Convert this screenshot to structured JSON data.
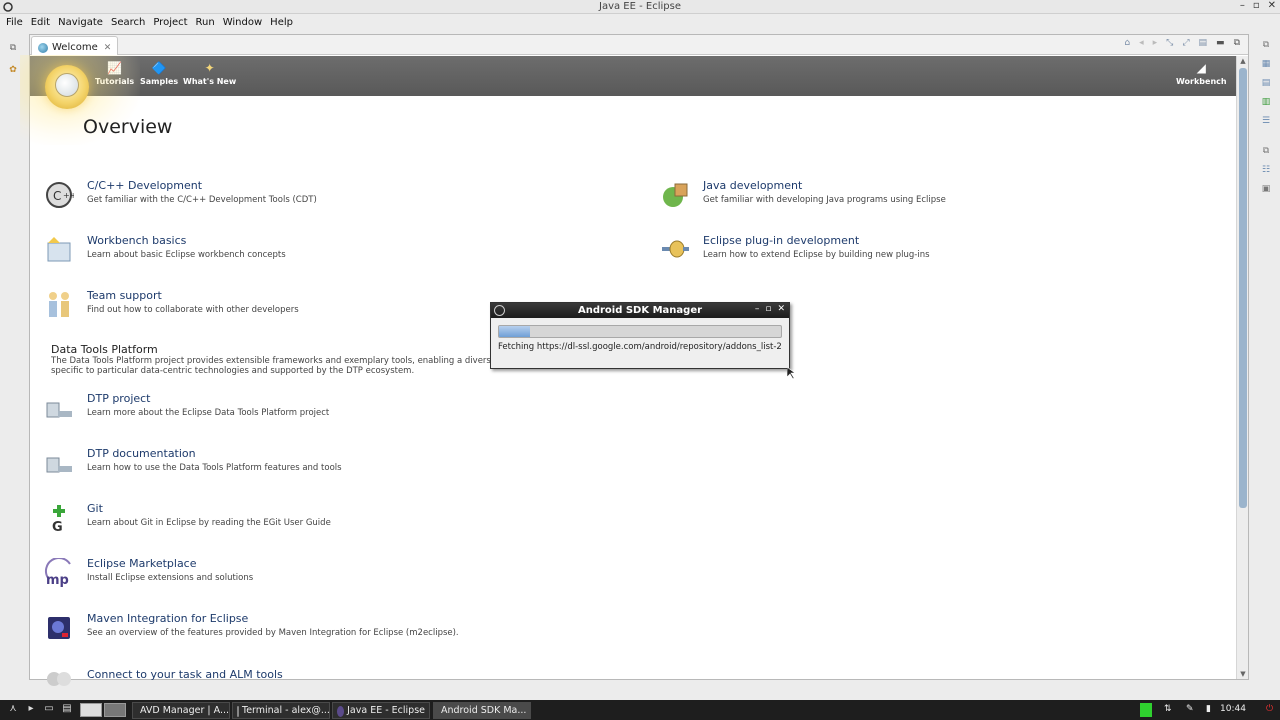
{
  "window": {
    "title": "Java EE - Eclipse"
  },
  "menu": [
    "File",
    "Edit",
    "Navigate",
    "Search",
    "Project",
    "Run",
    "Window",
    "Help"
  ],
  "tab": {
    "label": "Welcome",
    "close": "✕"
  },
  "header": {
    "links": [
      {
        "label": "Tutorials",
        "icon": "tutorials-icon"
      },
      {
        "label": "Samples",
        "icon": "samples-icon"
      },
      {
        "label": "What's New",
        "icon": "whats-new-icon"
      }
    ],
    "workbench": "Workbench"
  },
  "overview": {
    "title": "Overview"
  },
  "items": [
    {
      "title": "C/C++ Development",
      "desc": "Get familiar with the C/C++ Development Tools (CDT)"
    },
    {
      "title": "Workbench basics",
      "desc": "Learn about basic Eclipse workbench concepts"
    },
    {
      "title": "Team support",
      "desc": "Find out how to collaborate with other developers"
    },
    {
      "title": "DTP project",
      "desc": "Learn more about the Eclipse Data Tools Platform project"
    },
    {
      "title": "DTP documentation",
      "desc": "Learn how to use the Data Tools Platform features and tools"
    },
    {
      "title": "Git",
      "desc": "Learn about Git in Eclipse by reading the EGit User Guide"
    },
    {
      "title": "Eclipse Marketplace",
      "desc": "Install Eclipse extensions and solutions"
    },
    {
      "title": "Maven Integration for Eclipse",
      "desc": "See an overview of the features provided by Maven Integration for Eclipse (m2eclipse)."
    },
    {
      "title": "Connect to your task and ALM tools",
      "desc": ""
    }
  ],
  "right_items": [
    {
      "title": "Java development",
      "desc": "Get familiar with developing Java programs using Eclipse"
    },
    {
      "title": "Eclipse plug-in development",
      "desc": "Learn how to extend Eclipse by building new plug-ins"
    }
  ],
  "dtp_section": {
    "title": "Data Tools Platform",
    "desc_line1": "The Data Tools Platform project provides extensible frameworks and exemplary tools, enabling a diverse s",
    "desc_line2": "specific to particular data-centric technologies and supported by the DTP ecosystem."
  },
  "dialog": {
    "title": "Android SDK Manager",
    "status": "Fetching https://dl-ssl.google.com/android/repository/addons_list-2",
    "progress": 0.11,
    "buttons": [
      "–",
      "▫",
      "✕"
    ]
  },
  "taskbar": {
    "tasks": [
      {
        "label": "AVD Manager | A..."
      },
      {
        "label": "Terminal - alex@..."
      },
      {
        "label": "Java EE - Eclipse"
      },
      {
        "label": "Android SDK Ma..."
      }
    ],
    "clock": "10:44"
  },
  "colors": {
    "header_bg": "#5f5f5f",
    "link_text": "#1d3a6b",
    "highlight": "#fff5c4",
    "dialog_title_bg": "#262626",
    "progress_fill": "#7aa6dc",
    "taskbar_bg": "#1e1e1e"
  }
}
